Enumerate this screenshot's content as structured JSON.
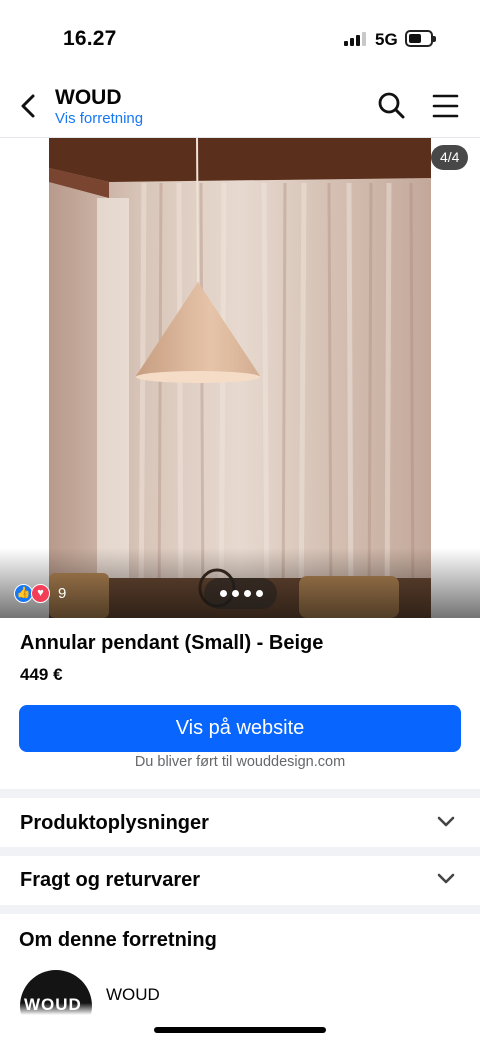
{
  "status_bar": {
    "time": "16.27",
    "network": "5G",
    "signal_bars": 4,
    "signal_bars_active": 3
  },
  "header": {
    "title": "WOUD",
    "subtitle": "Vis forretning",
    "back_icon": "chevron-left-icon",
    "search_icon": "search-icon",
    "menu_icon": "hamburger-menu-icon"
  },
  "photo": {
    "counter": "4/4",
    "reaction_count": "9",
    "reaction_icons": [
      "like-icon",
      "love-icon"
    ],
    "dots": 4
  },
  "product": {
    "title": "Annular pendant (Small) - Beige",
    "price": "449 €",
    "cta_label": "Vis på website",
    "cta_note": "Du bliver ført til wouddesign.com"
  },
  "sections": [
    {
      "label": "Produktoplysninger",
      "icon": "chevron-down-icon"
    },
    {
      "label": "Fragt og returvarer",
      "icon": "chevron-down-icon"
    }
  ],
  "about": {
    "title": "Om denne forretning",
    "shop_name": "WOUD",
    "avatar_text": "WOUD"
  },
  "colors": {
    "accent": "#0866ff",
    "link": "#1877f2",
    "divider": "#f0f2f5",
    "muted": "#65676b"
  }
}
